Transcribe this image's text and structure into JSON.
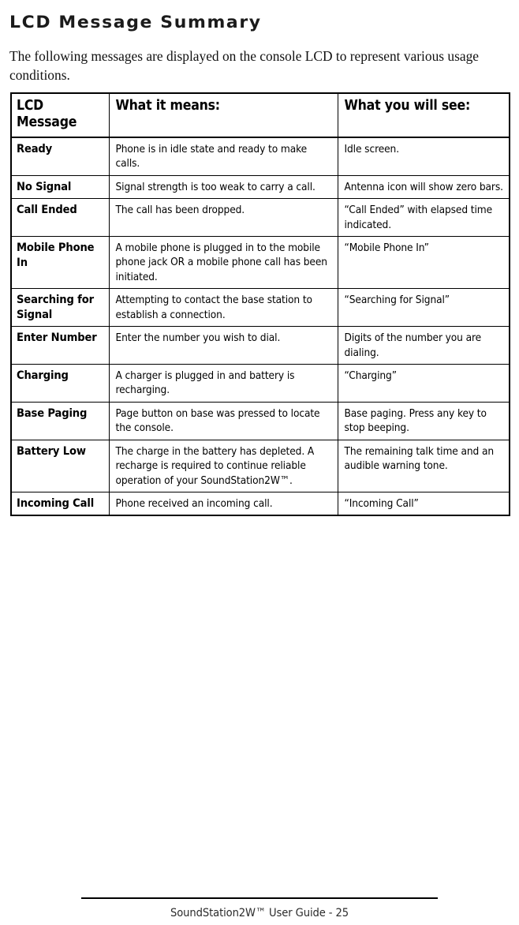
{
  "document": {
    "title": "LCD Message Summary",
    "intro": "The following messages are displayed on the console LCD to represent various usage conditions."
  },
  "table": {
    "headers": {
      "col1": "LCD Message",
      "col2": "What it means:",
      "col3": "What you will see:"
    },
    "rows": [
      {
        "message": "Ready",
        "means": "Phone is in idle state and ready to make calls.",
        "see": "Idle screen."
      },
      {
        "message": "No Signal",
        "means": "Signal strength is too weak to carry a call.",
        "see": "Antenna icon will show zero bars."
      },
      {
        "message": "Call Ended",
        "means": "The call has been dropped.",
        "see": "“Call Ended” with elapsed time indicated."
      },
      {
        "message": "Mobile Phone In",
        "means": "A mobile phone is plugged in to the mobile phone jack OR a mobile phone call has been initiated.",
        "see": "“Mobile Phone In”"
      },
      {
        "message": "Searching for Signal",
        "means": "Attempting to contact the base station to establish a connection.",
        "see": "“Searching for Signal”"
      },
      {
        "message": "Enter Number",
        "means": "Enter the number you wish to dial.",
        "see": "Digits of the number you are dialing."
      },
      {
        "message": "Charging",
        "means": "A charger is plugged in and battery is recharging.",
        "see": "“Charging”"
      },
      {
        "message": "Base Paging",
        "means": "Page button on base was pressed to locate the console.",
        "see": "Base paging.  Press any key to stop beeping."
      },
      {
        "message": "Battery Low",
        "means": "The charge in the battery has depleted.  A recharge is required to continue reliable operation of your SoundStation2W™.",
        "see": "The remaining talk time and an audible warning tone."
      },
      {
        "message": "Incoming Call",
        "means": "Phone received an incoming call.",
        "see": "“Incoming Call”"
      }
    ]
  },
  "footer": {
    "text": "SoundStation2W™ User Guide - 25"
  }
}
